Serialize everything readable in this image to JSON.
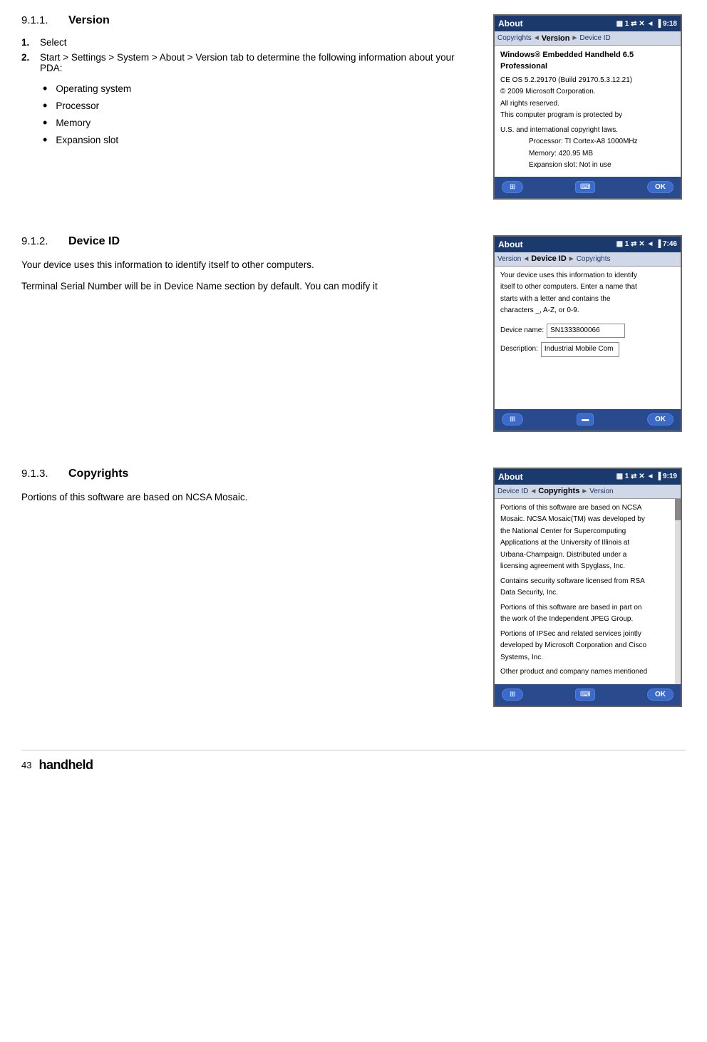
{
  "sections": [
    {
      "id": "version",
      "heading_num": "9.1.1.",
      "heading_title": "Version",
      "steps": [
        {
          "num": "1.",
          "text": "Select"
        },
        {
          "num": "2.",
          "text": "Start > Settings > System > About > Version tab to determine the following information about your PDA:"
        }
      ],
      "bullets": [
        "Operating system",
        "Processor",
        "Memory",
        "Expansion slot"
      ],
      "device": {
        "titlebar": "About",
        "titlebar_icons": "▦ 1 ⇄ ✕ ◄ ▐ 9:18",
        "tabs": [
          "Copyrights",
          "<",
          "Version",
          ">",
          "Device ID"
        ],
        "active_tab": "Version",
        "content_title": "Windows® Embedded Handheld 6.5 Professional",
        "content_lines": [
          "CE OS 5.2.29170 (Build 29170.5.3.12.21)",
          "© 2009 Microsoft Corporation.",
          "All rights reserved.",
          "",
          "This computer program is protected by",
          "U.S. and international copyright laws."
        ],
        "content_indented": [
          "Processor:  TI Cortex-A8 1000MHz",
          "Memory:  420.95 MB",
          "Expansion slot:  Not in use"
        ],
        "toolbar": {
          "left": "⊞",
          "middle": "⌨",
          "right": "OK"
        }
      }
    },
    {
      "id": "device-id",
      "heading_num": "9.1.2.",
      "heading_title": "Device ID",
      "body_paragraphs": [
        "Your device uses this information to identify itself to other computers.",
        "Terminal Serial Number will be in Device Name section by default. You can modify it"
      ],
      "device": {
        "titlebar": "About",
        "titlebar_icons": "▦ 1 ⇄ ✕ ◄ ▐ 7:46",
        "tabs": [
          "Version",
          "<",
          "Device ID",
          ">",
          "Copyrights"
        ],
        "active_tab": "Device ID",
        "content_lines": [
          "Your device uses this information to identify",
          "itself to other computers. Enter a name that",
          "starts with a letter and contains the",
          "characters _, A-Z, or 0-9."
        ],
        "fields": [
          {
            "label": "Device name:",
            "value": "SN1333800066"
          },
          {
            "label": "Description:",
            "value": "Industrial Mobile Com"
          }
        ],
        "toolbar": {
          "left": "⊞",
          "middle": "▬",
          "right": "OK"
        }
      }
    },
    {
      "id": "copyrights",
      "heading_num": "9.1.3.",
      "heading_title": "Copyrights",
      "body_paragraphs": [
        "Portions of this software are based on NCSA Mosaic."
      ],
      "device": {
        "titlebar": "About",
        "titlebar_icons": "▦ 1 ⇄ ✕ ◄ ▐ 9:19",
        "tabs": [
          "Device ID",
          "<",
          "Copyrights",
          ">",
          "Version"
        ],
        "active_tab": "Copyrights",
        "content_lines": [
          "Portions of this software are based on NCSA",
          "Mosaic. NCSA Mosaic(TM) was developed by",
          "the National Center for Supercomputing",
          "Applications at the University of Illinois at",
          "Urbana-Champaign. Distributed under a",
          "licensing agreement with Spyglass, Inc.",
          "",
          "Contains security software licensed from RSA",
          "Data Security, Inc.",
          "",
          "Portions of this software are based in part on",
          "the work of the Independent JPEG Group.",
          "",
          "Portions of IPSec and related services jointly",
          "developed by Microsoft Corporation and Cisco",
          "Systems, Inc.",
          "",
          "Other product and company names mentioned"
        ],
        "toolbar": {
          "left": "⊞",
          "middle": "⌨",
          "right": "OK"
        }
      }
    }
  ],
  "footer": {
    "page_num": "43",
    "brand": "handheld"
  }
}
